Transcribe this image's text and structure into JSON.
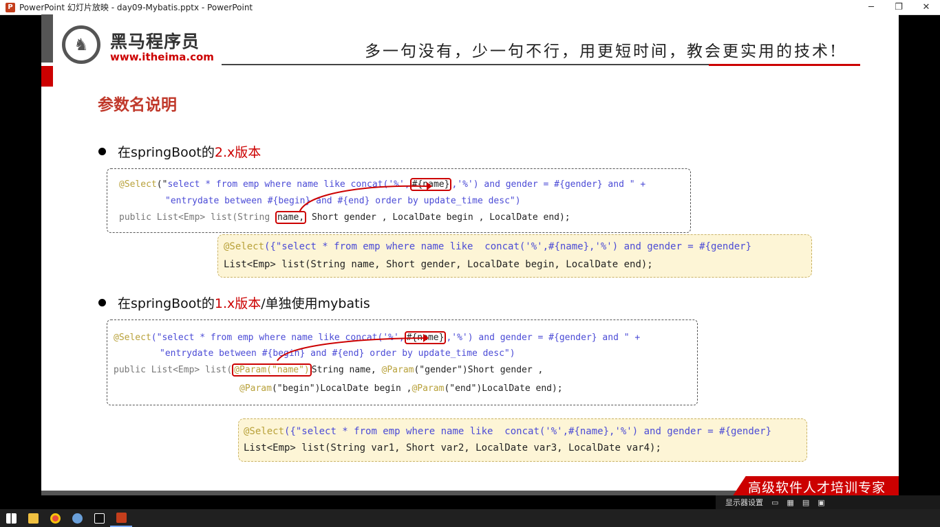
{
  "window": {
    "title": "PowerPoint 幻灯片放映  -  day09-Mybatis.pptx  -  PowerPoint",
    "minimize_icon": "minimize-icon",
    "maximize_icon": "restore-icon",
    "close_icon": "close-icon"
  },
  "logo": {
    "brand_cn": "黑马程序员",
    "url": "www.itheima.com"
  },
  "slogan": "多一句没有，少一句不行，用更短时间，教会更实用的技术!",
  "heading": "参数名说明",
  "section1": {
    "prefix": "在springBoot的",
    "version": "2.x版本",
    "suffix": ""
  },
  "section2": {
    "prefix": "在springBoot的",
    "version": "1.x版本",
    "suffix": "/单独使用mybatis"
  },
  "code1": {
    "l1_anno": "@Select",
    "l1_a": "(\"",
    "l1_b": "select * from emp where name like concat('%',",
    "l1_name": "#{name}",
    "l1_c": ",'%') and gender = #{gender} and \" +",
    "l2": "\"entrydate between #{begin} and #{end} order by update_time desc\")",
    "l3_a": "public List<Emp> list(String ",
    "l3_name": "name,",
    "l3_b": " Short gender , LocalDate begin , LocalDate end);"
  },
  "hl1": {
    "l1_anno": "@Select",
    "l1_rest": "({\"select * from emp where name like  concat('%',#{name},'%') and gender = #{gender}",
    "l2": "List<Emp> list(String name, Short gender, LocalDate begin, LocalDate end);"
  },
  "code2": {
    "l1_anno": "@Select",
    "l1_a": "(\"select * from emp where name like concat('%',",
    "l1_name": "#{name}",
    "l1_c": ",'%') and gender = #{gender} and \" +",
    "l2": "\"entrydate between #{begin} and #{end} order by update_time desc\")",
    "l3_a": "public List<Emp> list(",
    "l3_param": "@Param(\"name\")",
    "l3_b": "String name, ",
    "l3_anno2": "@Param",
    "l3_c": "(\"gender\")Short gender ,",
    "l4_anno1": "@Param",
    "l4_a": "(\"begin\")LocalDate begin ,",
    "l4_anno2": "@Param",
    "l4_b": "(\"end\")LocalDate end);"
  },
  "hl2": {
    "l1_anno": "@Select",
    "l1_rest": "({\"select * from emp where name like  concat('%',#{name},'%') and gender = #{gender}",
    "l2": "List<Emp> list(String var1, Short var2, LocalDate var3, LocalDate var4);"
  },
  "banner": "高级软件人才培训专家",
  "statusbar": {
    "display_settings": "显示器设置"
  },
  "taskbar": {
    "start_icon": "windows-start-icon",
    "explorer_icon": "file-explorer-icon",
    "chrome_icon": "chrome-icon",
    "app_icon": "app-icon",
    "idea_icon": "intellij-icon",
    "ppt_icon": "powerpoint-icon"
  }
}
